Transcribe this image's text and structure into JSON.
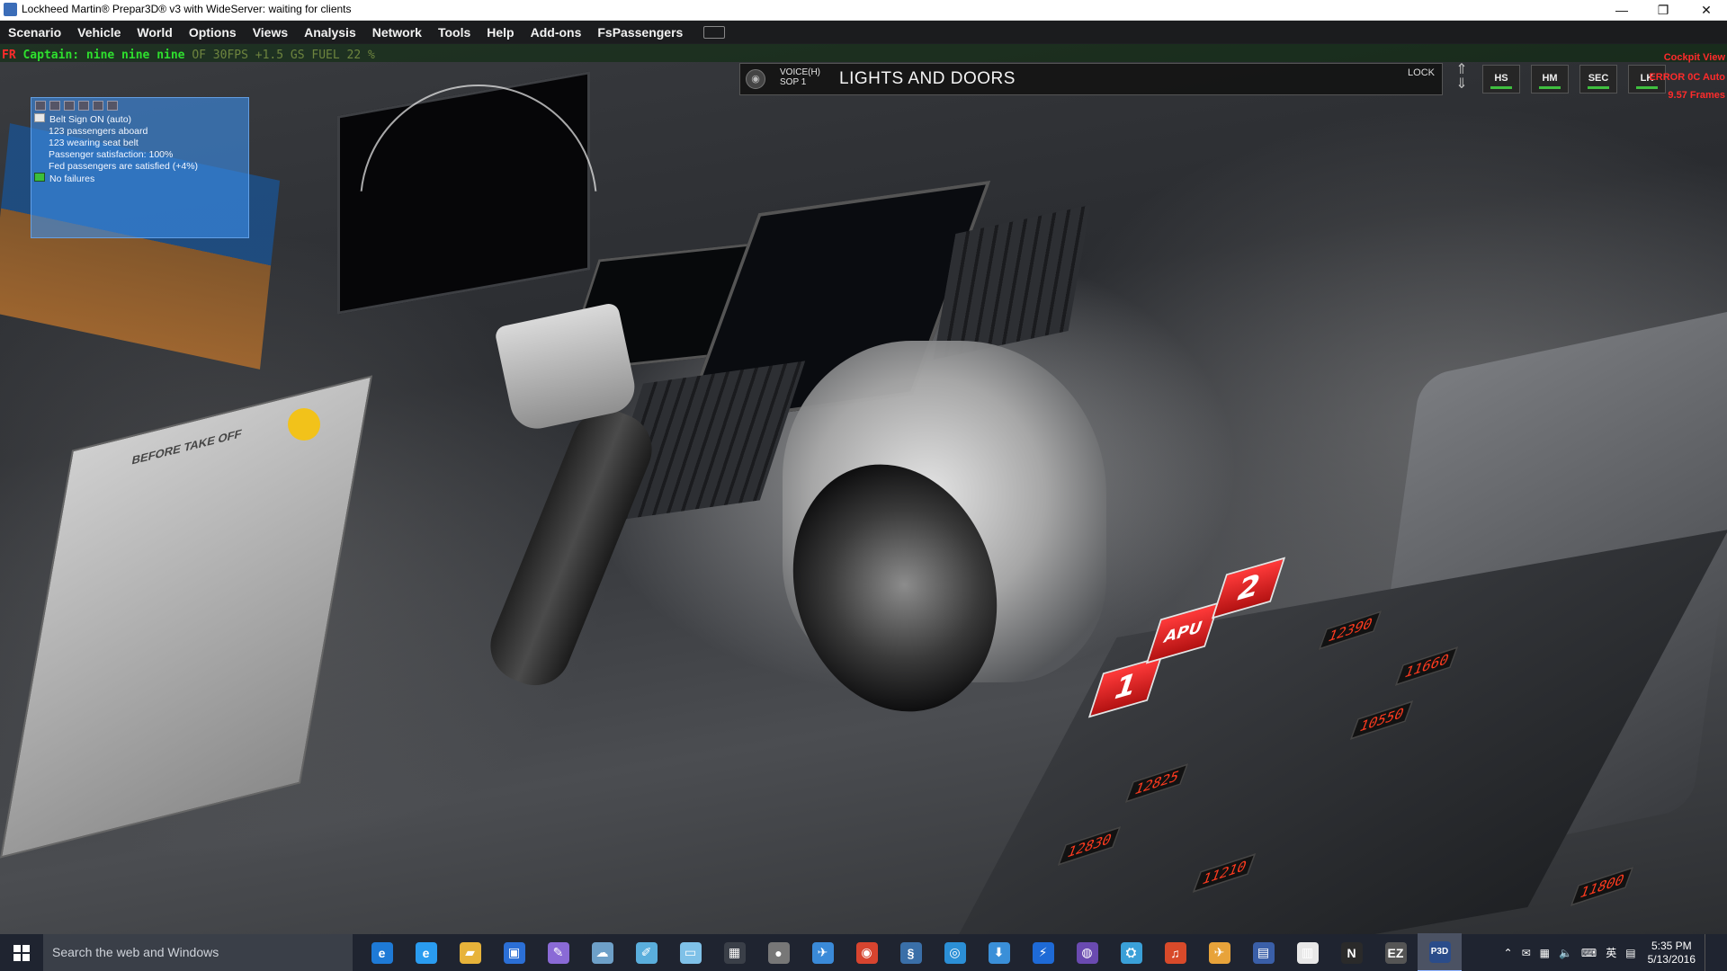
{
  "window": {
    "title": "Lockheed Martin® Prepar3D® v3 with WideServer: waiting for clients",
    "controls": {
      "minimize": "—",
      "maximize": "❐",
      "close": "✕"
    }
  },
  "menu": {
    "items": [
      "Scenario",
      "Vehicle",
      "World",
      "Options",
      "Views",
      "Analysis",
      "Network",
      "Tools",
      "Help",
      "Add-ons",
      "FsPassengers"
    ]
  },
  "status": {
    "prefix": "FR",
    "message": "Captain: nine nine nine",
    "extra": "OF 30FPS  +1.5 GS  FUEL 22 %"
  },
  "voice_bar": {
    "mode_line1": "VOICE(H)",
    "mode_line2": "SOP 1",
    "title": "LIGHTS AND DOORS",
    "lock": "LOCK",
    "buttons": [
      "HS",
      "HM",
      "SEC",
      "LK"
    ]
  },
  "topright": {
    "line1": "Cockpit View",
    "line2": "ERROR 0C  Auto",
    "line3": "9.57 Frames"
  },
  "fspassengers": {
    "lines": [
      {
        "text": "Belt Sign ON (auto)",
        "icon": "check"
      },
      {
        "text": "123 passengers aboard",
        "icon": "none"
      },
      {
        "text": "123 wearing seat belt",
        "icon": "none"
      },
      {
        "text": "Passenger satisfaction: 100%",
        "icon": "none"
      },
      {
        "text": "Fed passengers are satisfied (+4%)",
        "icon": "none"
      },
      {
        "text": "No failures",
        "icon": "ok"
      }
    ]
  },
  "cockpit": {
    "checklist_heading": "BEFORE TAKE OFF",
    "engine1": "1",
    "engine2": "2",
    "apu": "APU",
    "led_values": [
      "12830",
      "12825",
      "11210",
      "12390",
      "11660",
      "10550",
      "11800"
    ]
  },
  "taskbar": {
    "search_placeholder": "Search the web and Windows",
    "apps": [
      {
        "name": "edge",
        "glyph": "e",
        "color": "#1e7ad6"
      },
      {
        "name": "internet-explorer",
        "glyph": "e",
        "color": "#2a9cf0"
      },
      {
        "name": "file-explorer",
        "glyph": "▰",
        "color": "#e7b33a"
      },
      {
        "name": "store",
        "glyph": "▣",
        "color": "#2b6fd6"
      },
      {
        "name": "app-pen",
        "glyph": "✎",
        "color": "#8a6ad6"
      },
      {
        "name": "app-cloud",
        "glyph": "☁",
        "color": "#6ea0c8"
      },
      {
        "name": "app-brush",
        "glyph": "✐",
        "color": "#5aaedc"
      },
      {
        "name": "app-notes",
        "glyph": "▭",
        "color": "#7fc1e8"
      },
      {
        "name": "calculator",
        "glyph": "▦",
        "color": "#3a3f48"
      },
      {
        "name": "app-sphere",
        "glyph": "●",
        "color": "#777"
      },
      {
        "name": "app-plane",
        "glyph": "✈",
        "color": "#3a8ad8"
      },
      {
        "name": "chrome",
        "glyph": "◉",
        "color": "#d7442f"
      },
      {
        "name": "python",
        "glyph": "§",
        "color": "#3a6fa8"
      },
      {
        "name": "app-teamspeak",
        "glyph": "◎",
        "color": "#2b8fd6"
      },
      {
        "name": "app-download",
        "glyph": "⬇",
        "color": "#3a8fd8"
      },
      {
        "name": "app-thunder",
        "glyph": "⚡",
        "color": "#1e6ad6"
      },
      {
        "name": "app-disc",
        "glyph": "◍",
        "color": "#6a4ab0"
      },
      {
        "name": "app-network",
        "glyph": "⛭",
        "color": "#3aa0d8"
      },
      {
        "name": "app-sound",
        "glyph": "♫",
        "color": "#d84a2a"
      },
      {
        "name": "app-aircraft",
        "glyph": "✈",
        "color": "#e8a33a"
      },
      {
        "name": "app-map",
        "glyph": "▤",
        "color": "#3a5fa8"
      },
      {
        "name": "app-doc",
        "glyph": "▥",
        "color": "#e8e8e8"
      },
      {
        "name": "app-n",
        "glyph": "N",
        "color": "#2a2a2a"
      },
      {
        "name": "app-ezca",
        "glyph": "EZ",
        "color": "#555"
      },
      {
        "name": "prepar3d",
        "glyph": "P3D",
        "color": "#2a4c8a"
      }
    ],
    "tray_lang": "英",
    "time": "5:35 PM",
    "date": "5/13/2016"
  }
}
